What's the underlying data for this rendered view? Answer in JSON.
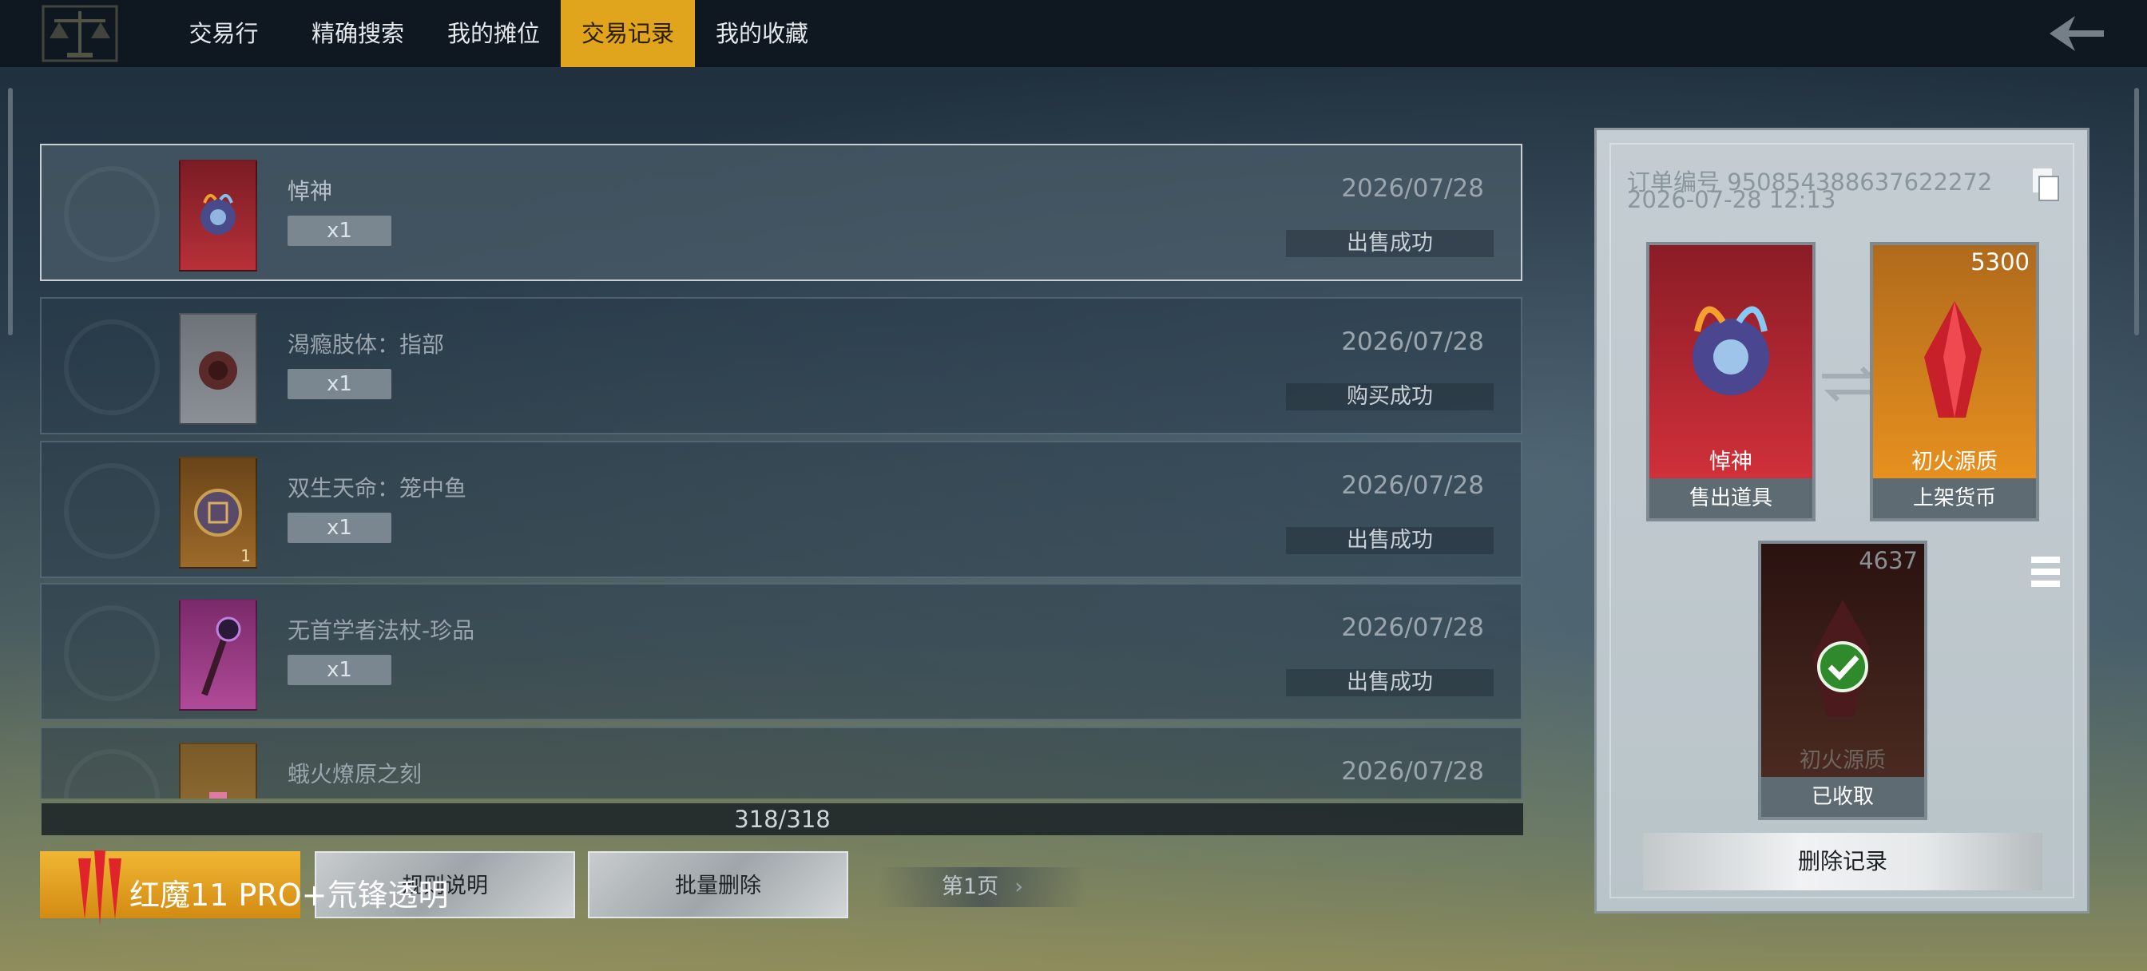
{
  "tabs": [
    {
      "label": "交易行"
    },
    {
      "label": "精确搜索"
    },
    {
      "label": "我的摊位"
    },
    {
      "label": "交易记录"
    },
    {
      "label": "我的收藏"
    }
  ],
  "records": [
    {
      "name": "悼神",
      "qty": "x1",
      "date": "2026/07/28",
      "status": "出售成功"
    },
    {
      "name": "渴瘾肢体：指部",
      "qty": "x1",
      "date": "2026/07/28",
      "status": "购买成功"
    },
    {
      "name": "双生天命：笼中鱼",
      "qty": "x1",
      "date": "2026/07/28",
      "status": "出售成功",
      "thumb_count": "1"
    },
    {
      "name": "无首学者法杖-珍品",
      "qty": "x1",
      "date": "2026/07/28",
      "status": "出售成功"
    },
    {
      "name": "蛾火燎原之刻",
      "qty": "",
      "date": "2026/07/28",
      "status": ""
    }
  ],
  "record_count": "318/318",
  "buttons": {
    "gold": "",
    "help": "规则说明",
    "batch_delete": "批量删除",
    "page": "第1页"
  },
  "watermark": "红魔11 PRO+氘锋透明",
  "detail": {
    "order_no": "订单编号 950854388637622272",
    "order_time": "2026-07-28 12:13",
    "sold_item": {
      "name": "悼神",
      "caption": "售出道具"
    },
    "listed_currency": {
      "name": "初火源质",
      "amount": "5300",
      "caption": "上架货币"
    },
    "received": {
      "name": "初火源质",
      "amount": "4637",
      "caption": "已收取"
    },
    "delete_label": "删除记录"
  },
  "colors": {
    "accent": "#e0a51c",
    "panel": "#c4cdd2",
    "topbar": "#0f1820"
  }
}
